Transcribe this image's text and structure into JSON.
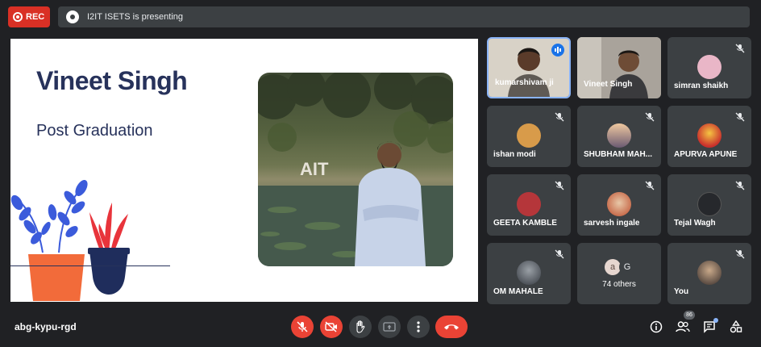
{
  "top_bar": {
    "rec_label": "REC",
    "presenting_text": "I2IT ISETS is presenting"
  },
  "slide": {
    "name": "Vineet Singh",
    "subtitle": "Post Graduation",
    "photo_sign_text": "AIT"
  },
  "participants": [
    {
      "name": "kumarshivam ji",
      "muted": false,
      "speaking": true,
      "type": "video"
    },
    {
      "name": "Vineet Singh",
      "muted": false,
      "speaking": false,
      "type": "video"
    },
    {
      "name": "simran shaikh",
      "muted": true,
      "type": "avatar"
    },
    {
      "name": "ishan modi",
      "muted": true,
      "type": "avatar"
    },
    {
      "name": "SHUBHAM MAH...",
      "muted": true,
      "type": "avatar"
    },
    {
      "name": "APURVA APUNE",
      "muted": true,
      "type": "avatar"
    },
    {
      "name": "GEETA KAMBLE",
      "muted": true,
      "type": "avatar"
    },
    {
      "name": "sarvesh ingale",
      "muted": true,
      "type": "avatar"
    },
    {
      "name": "Tejal Wagh",
      "muted": true,
      "type": "avatar"
    },
    {
      "name": "OM MAHALE",
      "muted": true,
      "type": "avatar"
    },
    {
      "name": "74 others",
      "type": "others",
      "initials": [
        "a",
        "G"
      ]
    },
    {
      "name": "You",
      "muted": true,
      "type": "avatar"
    }
  ],
  "bottom_bar": {
    "meeting_code": "abg-kypu-rgd",
    "people_count": "86"
  },
  "colors": {
    "background": "#202124",
    "tile": "#3c4043",
    "danger": "#ea4335",
    "accent": "#8ab4f8",
    "slide_text": "#27325b"
  }
}
